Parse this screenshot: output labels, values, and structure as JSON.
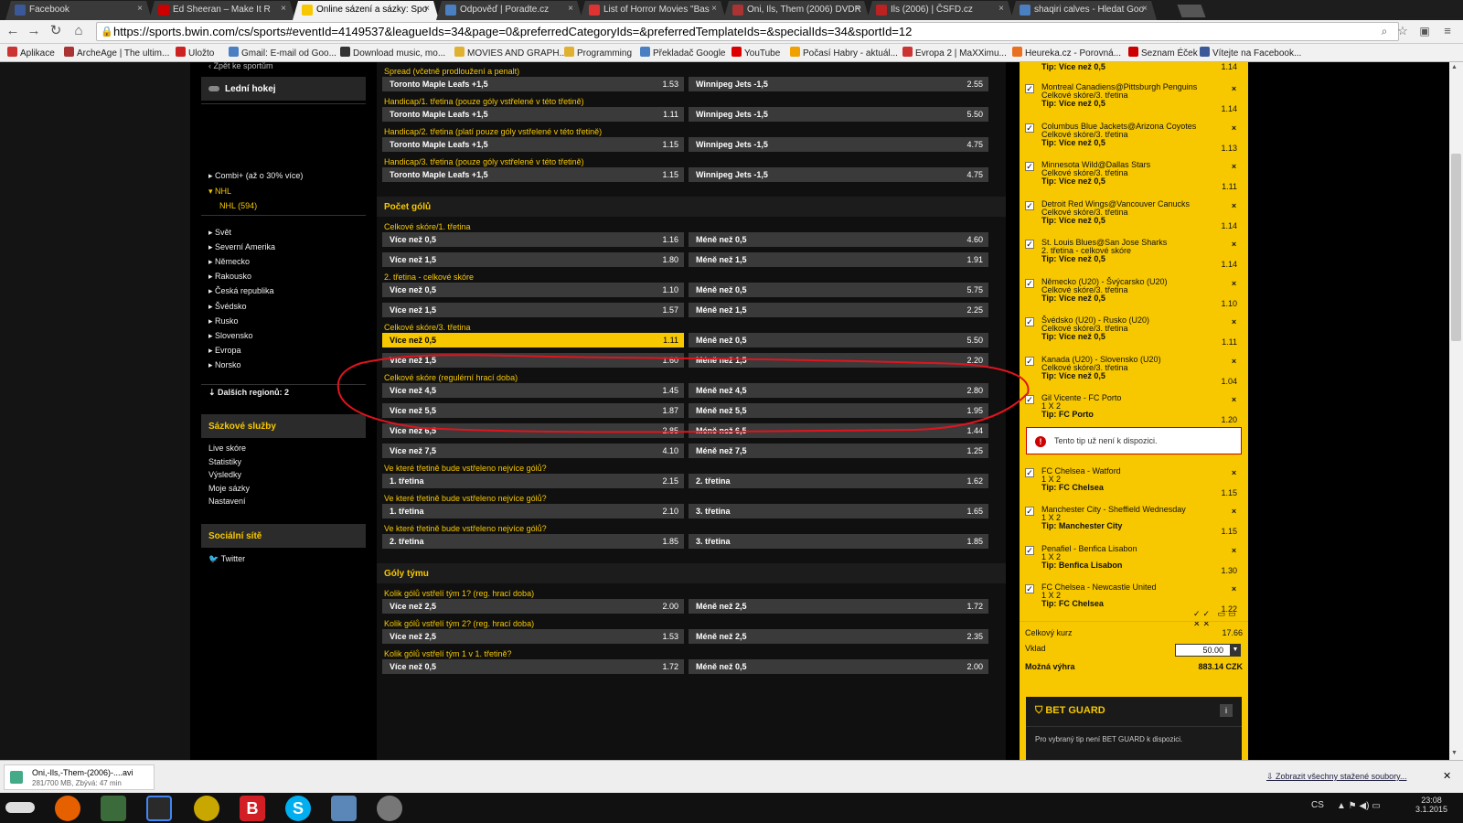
{
  "browser": {
    "tabs": [
      {
        "title": "Facebook",
        "color": "#3b5998",
        "active": false
      },
      {
        "title": "Ed Sheeran – Make It R",
        "color": "#cc0000",
        "active": false
      },
      {
        "title": "Online sázení a sázky: Spo",
        "color": "#f7c800",
        "active": true
      },
      {
        "title": "Odpověď | Poradte.cz",
        "color": "#4a7fc1",
        "active": false
      },
      {
        "title": "List of Horror Movies \"Bas",
        "color": "#d33",
        "active": false
      },
      {
        "title": "Oni, Ils, Them (2006) DVDR",
        "color": "#a33",
        "active": false
      },
      {
        "title": "Ils (2006) | ČSFD.cz",
        "color": "#b22",
        "active": false
      },
      {
        "title": "shaqiri calves - Hledat Goo",
        "color": "#4a7fc1",
        "active": false
      }
    ],
    "url": "https://sports.bwin.com/cs/sports#eventId=4149537&leagueIds=34&page=0&preferredCategoryIds=&preferredTemplateIds=&specialIds=34&sportId=12",
    "bookmarks": [
      "Aplikace",
      "ArcheAge | The ultim...",
      "Uložto",
      "Gmail: E-mail od Goo...",
      "Download music, mo...",
      "MOVIES AND GRAPH...",
      "Programming",
      "Překladač Google",
      "YouTube",
      "Počasí Habry - aktuál...",
      "Evropa 2 | MaXXimu...",
      "Heureka.cz - Porovná...",
      "Seznam Éček",
      "Vítejte na Facebook..."
    ]
  },
  "left": {
    "back": "Zpět ke sportům",
    "sport": "Lední hokej",
    "items": [
      "Combi+ (až o 30% více)",
      "NHL",
      "NHL (594)",
      "Svět",
      "Severní Amerika",
      "Německo",
      "Rakousko",
      "Česká republika",
      "Švédsko",
      "Rusko",
      "Slovensko",
      "Evropa",
      "Norsko"
    ],
    "more": "Dalších regionů: 2",
    "services_title": "Sázkové služby",
    "services": [
      "Live skóre",
      "Statistiky",
      "Výsledky",
      "Moje sázky",
      "Nastavení"
    ],
    "social_title": "Sociální sítě",
    "twitter": "Twitter"
  },
  "markets": [
    {
      "type": "sub",
      "label": "Spread (včetně prodloužení a penalt)"
    },
    {
      "type": "row",
      "a": "Toronto Maple Leafs +1,5",
      "av": "1.53",
      "b": "Winnipeg Jets -1,5",
      "bv": "2.55"
    },
    {
      "type": "sub",
      "label": "Handicap/1. třetina (pouze góly vstřelené v této třetině)"
    },
    {
      "type": "row",
      "a": "Toronto Maple Leafs +1,5",
      "av": "1.11",
      "b": "Winnipeg Jets -1,5",
      "bv": "5.50"
    },
    {
      "type": "sub",
      "label": "Handicap/2. třetina (platí pouze góly vstřelené v této třetině)"
    },
    {
      "type": "row",
      "a": "Toronto Maple Leafs +1,5",
      "av": "1.15",
      "b": "Winnipeg Jets -1,5",
      "bv": "4.75"
    },
    {
      "type": "sub",
      "label": "Handicap/3. třetina (pouze góly vstřelené v této třetině)"
    },
    {
      "type": "row",
      "a": "Toronto Maple Leafs +1,5",
      "av": "1.15",
      "b": "Winnipeg Jets -1,5",
      "bv": "4.75"
    },
    {
      "type": "sect",
      "label": "Počet gólů"
    },
    {
      "type": "sub",
      "label": "Celkové skóre/1. třetina"
    },
    {
      "type": "row",
      "a": "Více než 0,5",
      "av": "1.16",
      "b": "Méně než 0,5",
      "bv": "4.60"
    },
    {
      "type": "row",
      "a": "Více než 1,5",
      "av": "1.80",
      "b": "Méně než 1,5",
      "bv": "1.91"
    },
    {
      "type": "sub",
      "label": "2. třetina - celkové skóre"
    },
    {
      "type": "row",
      "a": "Více než 0,5",
      "av": "1.10",
      "b": "Méně než 0,5",
      "bv": "5.75"
    },
    {
      "type": "row",
      "a": "Více než 1,5",
      "av": "1.57",
      "b": "Méně než 1,5",
      "bv": "2.25"
    },
    {
      "type": "sub",
      "label": "Celkové skóre/3. třetina"
    },
    {
      "type": "row",
      "a": "Více než 0,5",
      "av": "1.11",
      "b": "Méně než 0,5",
      "bv": "5.50",
      "sel": true
    },
    {
      "type": "row",
      "a": "Více než 1,5",
      "av": "1.60",
      "b": "Méně než 1,5",
      "bv": "2.20"
    },
    {
      "type": "sub",
      "label": "Celkové skóre (regulérní hrací doba)"
    },
    {
      "type": "row",
      "a": "Více než 4,5",
      "av": "1.45",
      "b": "Méně než 4,5",
      "bv": "2.80"
    },
    {
      "type": "row",
      "a": "Více než 5,5",
      "av": "1.87",
      "b": "Méně než 5,5",
      "bv": "1.95"
    },
    {
      "type": "row",
      "a": "Více než 6,5",
      "av": "2.85",
      "b": "Méně než 6,5",
      "bv": "1.44"
    },
    {
      "type": "row",
      "a": "Více než 7,5",
      "av": "4.10",
      "b": "Méně než 7,5",
      "bv": "1.25"
    },
    {
      "type": "sub",
      "label": "Ve které třetině bude vstřeleno nejvíce gólů?"
    },
    {
      "type": "row",
      "a": "1. třetina",
      "av": "2.15",
      "b": "2. třetina",
      "bv": "1.62"
    },
    {
      "type": "sub",
      "label": "Ve které třetině bude vstřeleno nejvíce gólů?"
    },
    {
      "type": "row",
      "a": "1. třetina",
      "av": "2.10",
      "b": "3. třetina",
      "bv": "1.65"
    },
    {
      "type": "sub",
      "label": "Ve které třetině bude vstřeleno nejvíce gólů?"
    },
    {
      "type": "row",
      "a": "2. třetina",
      "av": "1.85",
      "b": "3. třetina",
      "bv": "1.85"
    },
    {
      "type": "sect",
      "label": "Góly týmu"
    },
    {
      "type": "sub",
      "label": "Kolik gólů vstřelí tým 1? (reg. hrací doba)"
    },
    {
      "type": "row",
      "a": "Více než 2,5",
      "av": "2.00",
      "b": "Méně než 2,5",
      "bv": "1.72"
    },
    {
      "type": "sub",
      "label": "Kolik gólů vstřelí tým 2? (reg. hrací doba)"
    },
    {
      "type": "row",
      "a": "Více než 2,5",
      "av": "1.53",
      "b": "Méně než 2,5",
      "bv": "2.35"
    },
    {
      "type": "sub",
      "label": "Kolik gólů vstřelí tým 1 v 1. třetině?"
    },
    {
      "type": "row",
      "a": "Více než 0,5",
      "av": "1.72",
      "b": "Méně než 0,5",
      "bv": "2.00"
    }
  ],
  "betslip": {
    "top_tip": "Tip: Více než 0,5",
    "top_odd": "1.14",
    "items": [
      {
        "match": "Montreal Canadiens@Pittsburgh Penguins",
        "market": "Celkové skóre/3. třetina",
        "tip": "Tip: Více než 0,5",
        "odd": "1.14"
      },
      {
        "match": "Columbus Blue Jackets@Arizona Coyotes",
        "market": "Celkové skóre/3. třetina",
        "tip": "Tip: Více než 0,5",
        "odd": "1.13"
      },
      {
        "match": "Minnesota Wild@Dallas Stars",
        "market": "Celkové skóre/3. třetina",
        "tip": "Tip: Více než 0,5",
        "odd": "1.11"
      },
      {
        "match": "Detroit Red Wings@Vancouver Canucks",
        "market": "Celkové skóre/3. třetina",
        "tip": "Tip: Více než 0,5",
        "odd": "1.14"
      },
      {
        "match": "St. Louis Blues@San Jose Sharks",
        "market": "2. třetina - celkové skóre",
        "tip": "Tip: Více než 0,5",
        "odd": "1.14"
      },
      {
        "match": "Německo (U20) - Švýcarsko (U20)",
        "market": "Celkové skóre/3. třetina",
        "tip": "Tip: Více než 0,5",
        "odd": "1.10"
      },
      {
        "match": "Švédsko (U20) - Rusko (U20)",
        "market": "Celkové skóre/3. třetina",
        "tip": "Tip: Více než 0,5",
        "odd": "1.11"
      },
      {
        "match": "Kanada (U20) - Slovensko (U20)",
        "market": "Celkové skóre/3. třetina",
        "tip": "Tip: Více než 0,5",
        "odd": "1.04"
      },
      {
        "match": "Gil Vicente - FC Porto",
        "market": "1 X 2",
        "tip": "Tip: FC Porto",
        "odd": "1.20"
      },
      {
        "match": "FC Chelsea - Watford",
        "market": "1 X 2",
        "tip": "Tip: FC Chelsea",
        "odd": "1.15"
      },
      {
        "match": "Manchester City - Sheffield Wednesday",
        "market": "1 X 2",
        "tip": "Tip: Manchester City",
        "odd": "1.15"
      },
      {
        "match": "Penafiel - Benfica Lisabon",
        "market": "1 X 2",
        "tip": "Tip: Benfica Lisabon",
        "odd": "1.30"
      },
      {
        "match": "FC Chelsea - Newcastle United",
        "market": "1 X 2",
        "tip": "Tip: FC Chelsea",
        "odd": "1.22"
      }
    ],
    "warning": "Tento tip už není k dispozici.",
    "total_label": "Celkový kurz",
    "total": "17.66",
    "stake_label": "Vklad",
    "stake": "50.00",
    "win_label": "Možná výhra",
    "win": "883.14 CZK",
    "betguard_title": "BET GUARD",
    "betguard_text": "Pro vybraný tip není BET GUARD k dispozici."
  },
  "download": {
    "file": "Oni,-Ils,-Them-(2006)-....avi",
    "status": "281/700 MB, Zbývá: 47 min",
    "showall": "Zobrazit všechny stažené soubory..."
  },
  "taskbar": {
    "lang": "CS",
    "time": "23:08",
    "date": "3.1.2015"
  },
  "colors": {
    "accent": "#f7c800",
    "annotation": "#e0141e"
  }
}
